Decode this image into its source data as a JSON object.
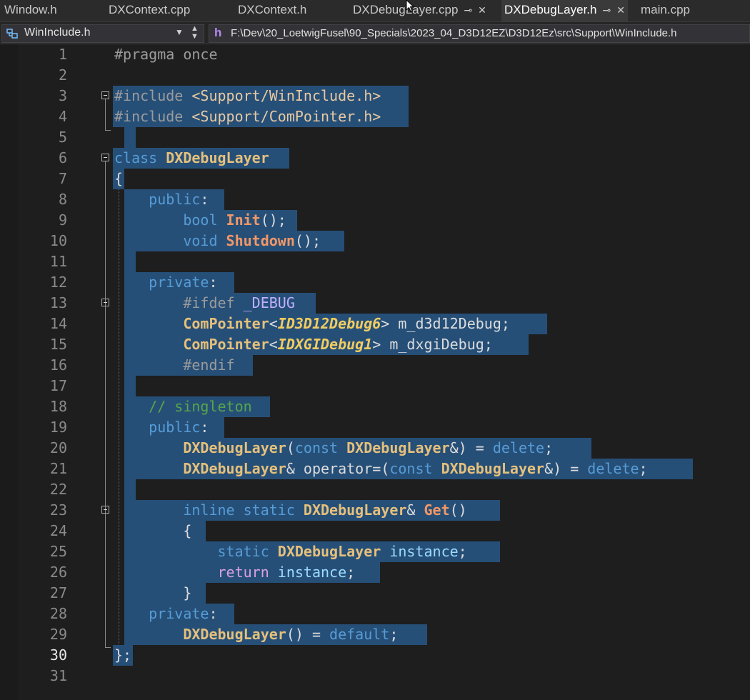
{
  "tabs": [
    {
      "label": "Window.h",
      "active": false,
      "pinned": false,
      "closable": false
    },
    {
      "label": "DXContext.cpp",
      "active": false,
      "pinned": false,
      "closable": false
    },
    {
      "label": "DXContext.h",
      "active": false,
      "pinned": false,
      "closable": false
    },
    {
      "label": "DXDebugLayer.cpp",
      "active": false,
      "pinned": true,
      "closable": true
    },
    {
      "label": "DXDebugLayer.h",
      "active": true,
      "pinned": true,
      "closable": true
    },
    {
      "label": "main.cpp",
      "active": false,
      "pinned": false,
      "closable": false
    }
  ],
  "navbar": {
    "scope_label": "WinInclude.h",
    "file_path": "F:\\Dev\\20_LoetwigFusel\\90_Specials\\2023_04_D3D12EZ\\D3D12Ez\\src\\Support\\WinInclude.h"
  },
  "editor": {
    "current_line": "30",
    "lines": [
      {
        "n": "1",
        "t": "#pragma once"
      },
      {
        "n": "2",
        "t": ""
      },
      {
        "n": "3",
        "t": "#include <Support/WinInclude.h>"
      },
      {
        "n": "4",
        "t": "#include <Support/ComPointer.h>"
      },
      {
        "n": "5",
        "t": ""
      },
      {
        "n": "6",
        "t": "class DXDebugLayer"
      },
      {
        "n": "7",
        "t": "{"
      },
      {
        "n": "8",
        "t": "    public:"
      },
      {
        "n": "9",
        "t": "        bool Init();"
      },
      {
        "n": "10",
        "t": "        void Shutdown();"
      },
      {
        "n": "11",
        "t": ""
      },
      {
        "n": "12",
        "t": "    private:"
      },
      {
        "n": "13",
        "t": "        #ifdef _DEBUG"
      },
      {
        "n": "14",
        "t": "        ComPointer<ID3D12Debug6> m_d3d12Debug;"
      },
      {
        "n": "15",
        "t": "        ComPointer<IDXGIDebug1> m_dxgiDebug;"
      },
      {
        "n": "16",
        "t": "        #endif"
      },
      {
        "n": "17",
        "t": ""
      },
      {
        "n": "18",
        "t": "    // singleton"
      },
      {
        "n": "19",
        "t": "    public:"
      },
      {
        "n": "20",
        "t": "        DXDebugLayer(const DXDebugLayer&) = delete;"
      },
      {
        "n": "21",
        "t": "        DXDebugLayer& operator=(const DXDebugLayer&) = delete;"
      },
      {
        "n": "22",
        "t": ""
      },
      {
        "n": "23",
        "t": "        inline static DXDebugLayer& Get()"
      },
      {
        "n": "24",
        "t": "        {"
      },
      {
        "n": "25",
        "t": "            static DXDebugLayer instance;"
      },
      {
        "n": "26",
        "t": "            return instance;"
      },
      {
        "n": "27",
        "t": "        }"
      },
      {
        "n": "28",
        "t": "    private:"
      },
      {
        "n": "29",
        "t": "        DXDebugLayer() = default;"
      },
      {
        "n": "30",
        "t": "};"
      },
      {
        "n": "31",
        "t": ""
      }
    ]
  },
  "colors": {
    "selection": "#264f78",
    "keyword": "#569cd6",
    "type": "#e5c07b",
    "function": "#f29766",
    "string": "#e8c9a0",
    "comment": "#57a64a",
    "preprocessor": "#9b9b9b"
  },
  "icons": {
    "nav_scope": "namespace-icon",
    "nav_header": "header-file-icon",
    "tab_pin": "pin-icon",
    "tab_close": "close-icon"
  }
}
